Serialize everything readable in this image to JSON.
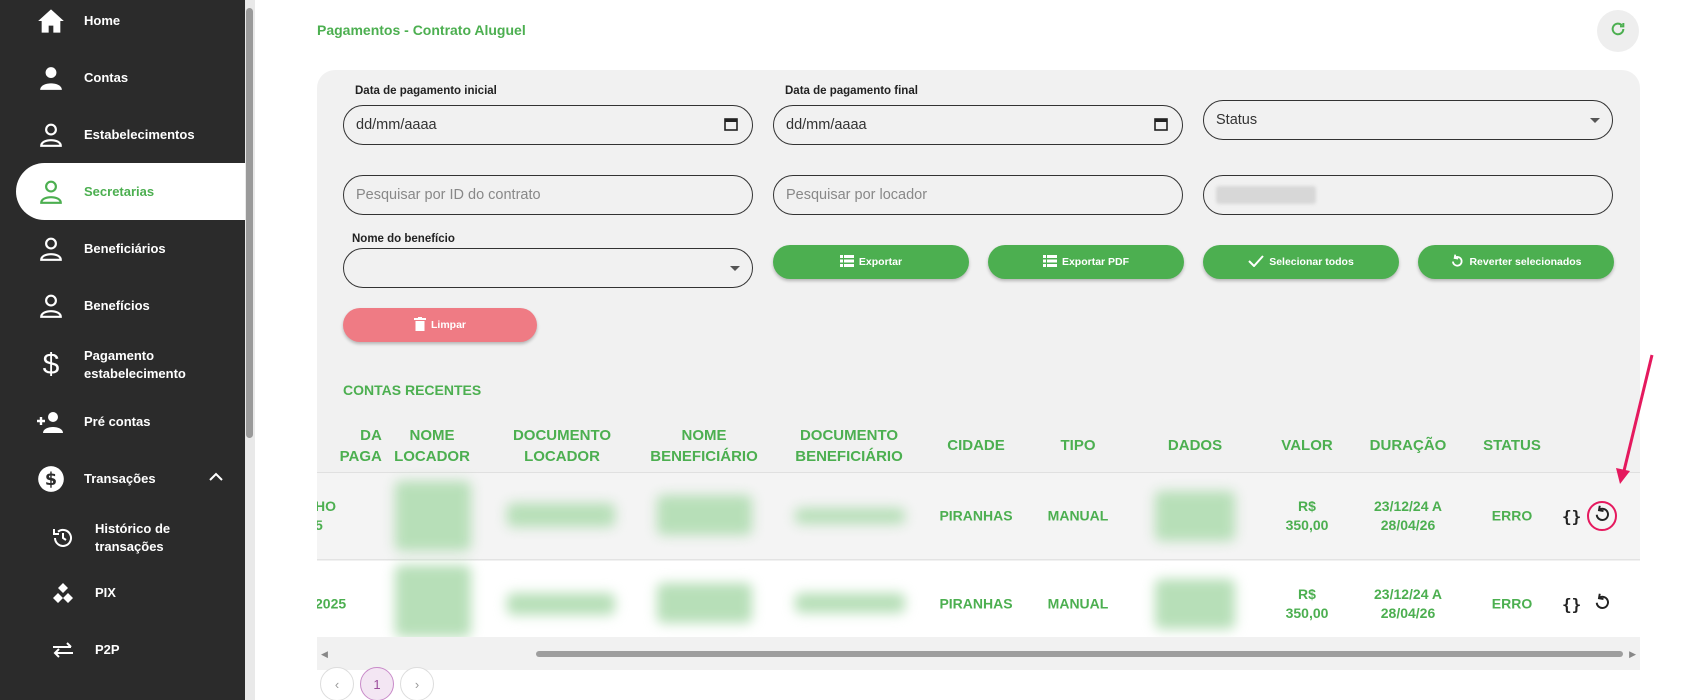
{
  "sidebar": {
    "items": [
      {
        "label": "Home",
        "icon": "home-icon"
      },
      {
        "label": "Contas",
        "icon": "user-icon"
      },
      {
        "label": "Estabelecimentos",
        "icon": "user-outline-icon"
      },
      {
        "label": "Secretarias",
        "icon": "user-outline-icon",
        "active": true
      },
      {
        "label": "Beneficiários",
        "icon": "user-outline-icon"
      },
      {
        "label": "Benefícios",
        "icon": "user-outline-icon"
      },
      {
        "label": "Pagamento estabelecimento",
        "icon": "dollar-icon"
      },
      {
        "label": "Pré contas",
        "icon": "user-add-icon"
      },
      {
        "label": "Transações",
        "icon": "dollar-circle-icon",
        "expanded": true
      }
    ],
    "subitems": [
      {
        "label": "Histórico de transações",
        "icon": "history-icon"
      },
      {
        "label": "PIX",
        "icon": "pix-icon"
      },
      {
        "label": "P2P",
        "icon": "transfer-icon"
      }
    ]
  },
  "header": {
    "title": "Pagamentos - Contrato Aluguel"
  },
  "filters": {
    "date_start_label": "Data de pagamento inicial",
    "date_start_placeholder": "dd/mm/aaaa",
    "date_end_label": "Data de pagamento final",
    "date_end_placeholder": "dd/mm/aaaa",
    "status_placeholder": "Status",
    "contract_id_placeholder": "Pesquisar por ID do contrato",
    "locador_placeholder": "Pesquisar por locador",
    "benefit_name_label": "Nome do benefício"
  },
  "buttons": {
    "export": "Exportar",
    "export_pdf": "Exportar PDF",
    "select_all": "Selecionar todos",
    "revert_selected": "Reverter selecionados",
    "clear": "Limpar"
  },
  "table": {
    "section_title": "CONTAS RECENTES",
    "headers": {
      "date": [
        "DA",
        "PAGA"
      ],
      "nome_locador": [
        "NOME",
        "LOCADOR"
      ],
      "doc_locador": [
        "DOCUMENTO",
        "LOCADOR"
      ],
      "nome_benef": [
        "NOME",
        "BENEFICIÁRIO"
      ],
      "doc_benef": [
        "DOCUMENTO",
        "BENEFICIÁRIO"
      ],
      "cidade": "CIDADE",
      "tipo": "TIPO",
      "dados": "DADOS",
      "valor": "VALOR",
      "duracao": "DURAÇÃO",
      "status": "STATUS"
    },
    "rows": [
      {
        "date": [
          "HO",
          "5"
        ],
        "cidade": "PIRANHAS",
        "tipo": "MANUAL",
        "valor": [
          "R$",
          "350,00"
        ],
        "duracao": [
          "23/12/24 A",
          "28/04/26"
        ],
        "status": "ERRO"
      },
      {
        "date": [
          "2025"
        ],
        "cidade": "PIRANHAS",
        "tipo": "MANUAL",
        "valor": [
          "R$",
          "350,00"
        ],
        "duracao": [
          "23/12/24 A",
          "28/04/26"
        ],
        "status": "ERRO"
      }
    ],
    "json_icon_text": "{}"
  },
  "pagination": {
    "prev": "‹",
    "current": "1",
    "next": "›"
  },
  "colors": {
    "accent": "#4caf50",
    "sidebar_bg": "#2b2b2b",
    "danger_button": "#ef7b84",
    "annotation": "#e5195e"
  }
}
